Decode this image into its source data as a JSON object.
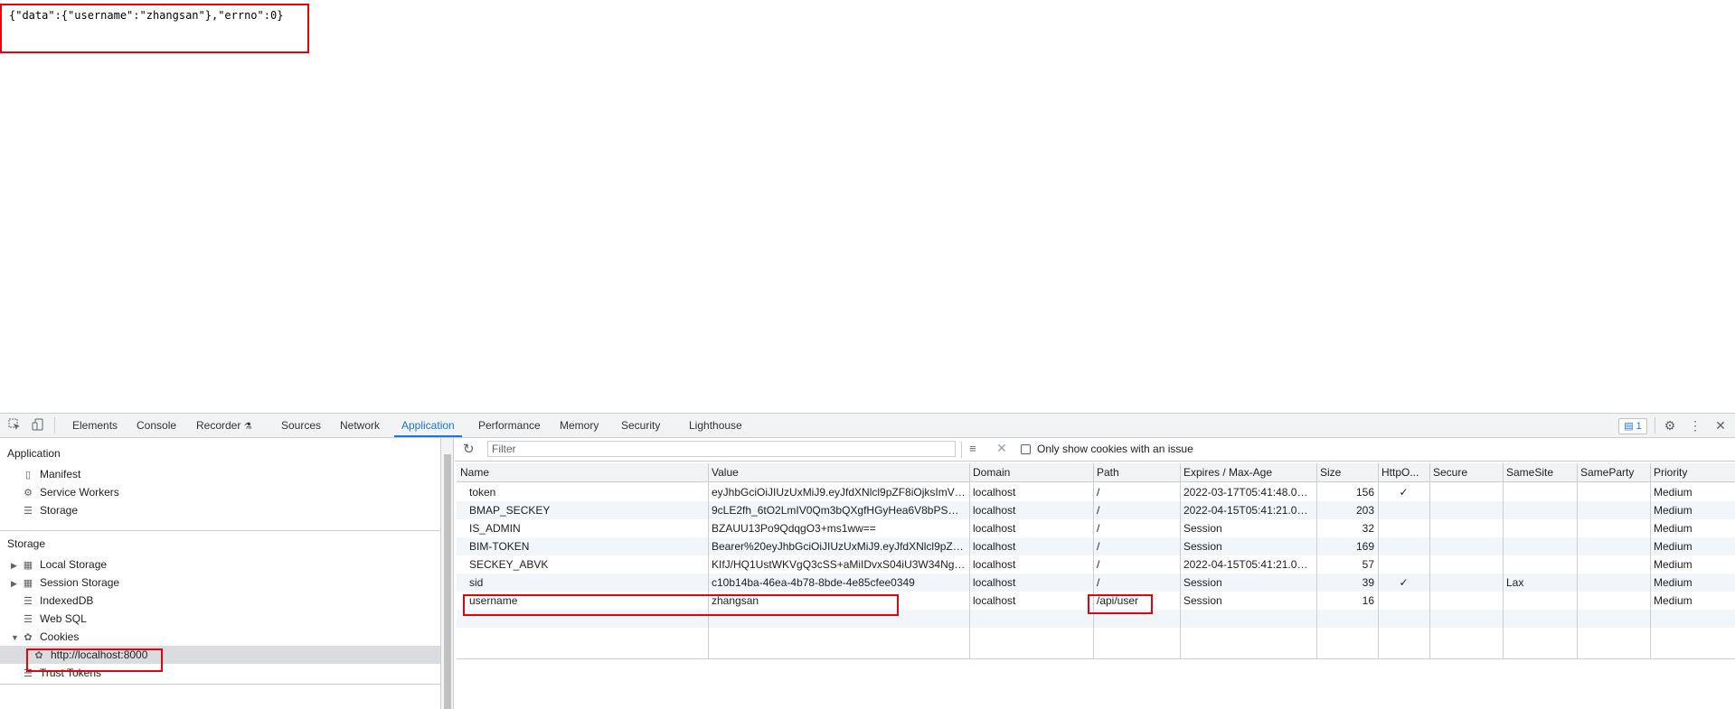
{
  "response_body": "{\"data\":{\"username\":\"zhangsan\"},\"errno\":0}",
  "devtools": {
    "tabs": [
      "Elements",
      "Console",
      "Recorder",
      "Sources",
      "Network",
      "Application",
      "Performance",
      "Memory",
      "Security",
      "Lighthouse"
    ],
    "active_tab": "Application",
    "issues_count": "1",
    "icons": {
      "inspect": "inspect-element-icon",
      "device": "device-toolbar-icon",
      "settings": "gear-icon",
      "more": "kebab-menu-icon",
      "close": "close-icon"
    }
  },
  "sidebar": {
    "application_header": "Application",
    "application_items": [
      "Manifest",
      "Service Workers",
      "Storage"
    ],
    "storage_header": "Storage",
    "storage_items": [
      "Local Storage",
      "Session Storage",
      "IndexedDB",
      "Web SQL",
      "Cookies"
    ],
    "cookie_origin": "http://localhost:8000",
    "trust_tokens": "Trust Tokens"
  },
  "cookies_toolbar": {
    "filter_placeholder": "Filter",
    "only_issue_label": "Only show cookies with an issue"
  },
  "cookies_table": {
    "columns": [
      "Name",
      "Value",
      "Domain",
      "Path",
      "Expires / Max-Age",
      "Size",
      "HttpO...",
      "Secure",
      "SameSite",
      "SameParty",
      "Priority"
    ],
    "rows": [
      {
        "name": "token",
        "value": "eyJhbGciOiJIUzUxMiJ9.eyJfdXNlcl9pZF8iOjksImV4c...",
        "domain": "localhost",
        "path": "/",
        "expires": "2022-03-17T05:41:48.002Z",
        "size": "156",
        "httponly": "✓",
        "secure": "",
        "samesite": "",
        "sameparty": "",
        "priority": "Medium"
      },
      {
        "name": "BMAP_SECKEY",
        "value": "9cLE2fh_6tO2LmIV0Qm3bQXgfHGyHea6V8bPSEfW...",
        "domain": "localhost",
        "path": "/",
        "expires": "2022-04-15T05:41:21.000Z",
        "size": "203",
        "httponly": "",
        "secure": "",
        "samesite": "",
        "sameparty": "",
        "priority": "Medium"
      },
      {
        "name": "IS_ADMIN",
        "value": "BZAUU13Po9QdqgO3+ms1ww==",
        "domain": "localhost",
        "path": "/",
        "expires": "Session",
        "size": "32",
        "httponly": "",
        "secure": "",
        "samesite": "",
        "sameparty": "",
        "priority": "Medium"
      },
      {
        "name": "BIM-TOKEN",
        "value": "Bearer%20eyJhbGciOiJIUzUxMiJ9.eyJfdXNlcl9pZF8i...",
        "domain": "localhost",
        "path": "/",
        "expires": "Session",
        "size": "169",
        "httponly": "",
        "secure": "",
        "samesite": "",
        "sameparty": "",
        "priority": "Medium"
      },
      {
        "name": "SECKEY_ABVK",
        "value": "KIfJ/HQ1UstWKVgQ3cSS+aMiIDvxS04iU3W34NgS9...",
        "domain": "localhost",
        "path": "/",
        "expires": "2022-04-15T05:41:21.000Z",
        "size": "57",
        "httponly": "",
        "secure": "",
        "samesite": "",
        "sameparty": "",
        "priority": "Medium"
      },
      {
        "name": "sid",
        "value": "c10b14ba-46ea-4b78-8bde-4e85cfee0349",
        "domain": "localhost",
        "path": "/",
        "expires": "Session",
        "size": "39",
        "httponly": "✓",
        "secure": "",
        "samesite": "Lax",
        "sameparty": "",
        "priority": "Medium"
      },
      {
        "name": "username",
        "value": "zhangsan",
        "domain": "localhost",
        "path": "/api/user",
        "expires": "Session",
        "size": "16",
        "httponly": "",
        "secure": "",
        "samesite": "",
        "sameparty": "",
        "priority": "Medium"
      }
    ]
  }
}
